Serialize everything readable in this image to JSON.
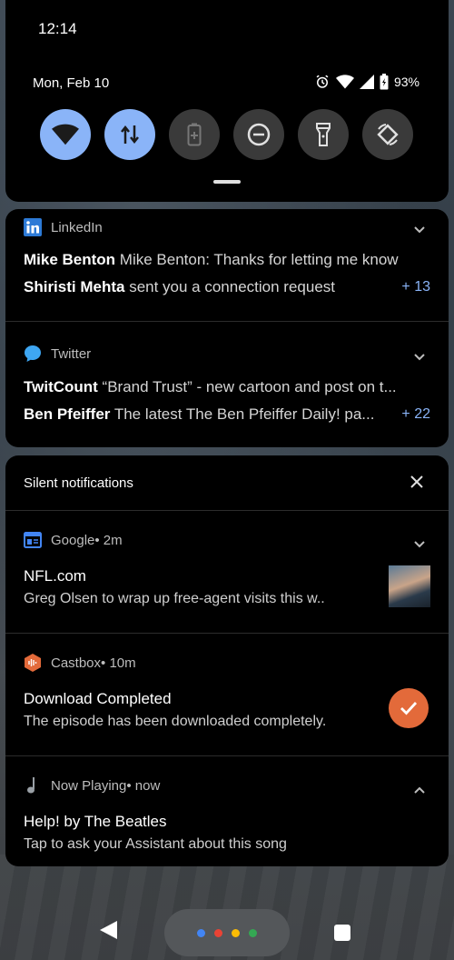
{
  "status": {
    "time": "12:14",
    "date": "Mon, Feb 10",
    "battery": "93%"
  },
  "tiles": [
    {
      "name": "wifi",
      "on": true
    },
    {
      "name": "mobile-data",
      "on": true
    },
    {
      "name": "battery-saver",
      "on": false
    },
    {
      "name": "do-not-disturb",
      "on": false
    },
    {
      "name": "flashlight",
      "on": false
    },
    {
      "name": "auto-rotate",
      "on": false
    }
  ],
  "linkedin": {
    "app": "LinkedIn",
    "line1_name": "Mike Benton",
    "line1_text": " Mike Benton: Thanks for letting me know",
    "line2_name": "Shiristi Mehta",
    "line2_text": " sent you a connection request",
    "count": "+ 13"
  },
  "twitter": {
    "app": "Twitter",
    "line1_name": "TwitCount",
    "line1_text": " “Brand Trust” - new cartoon and post on t...",
    "line2_name": "Ben Pfeiffer",
    "line2_text": " The latest The Ben Pfeiffer Daily! pa...",
    "count": "+ 22"
  },
  "silent": {
    "header": "Silent notifications"
  },
  "google": {
    "app": "Google",
    "time": " • 2m",
    "title": "NFL.com",
    "text": "Greg Olsen to wrap up free-agent visits this w.."
  },
  "castbox": {
    "app": "Castbox",
    "time": " • 10m",
    "title": "Download Completed",
    "text": "The episode has been downloaded completely."
  },
  "nowplaying": {
    "app": "Now Playing",
    "time": " • now",
    "title": "Help! by The Beatles",
    "text": "Tap to ask your Assistant about this song"
  },
  "colors": {
    "accent": "#8ab4f8",
    "castbox": "#e36a3a",
    "linkedin": "#0a66c2",
    "twitter": "#1d9bf0"
  }
}
